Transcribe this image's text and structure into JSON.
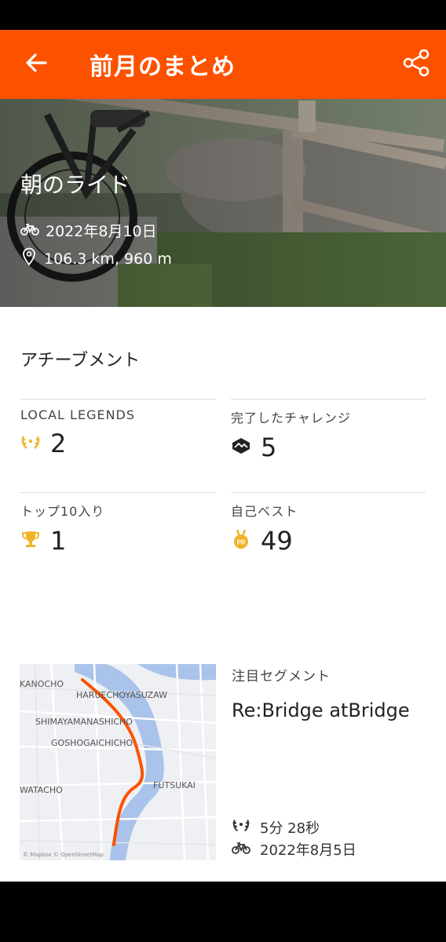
{
  "header": {
    "title": "前月のまとめ",
    "back_icon": "arrow-left-icon",
    "share_icon": "share-icon",
    "accent": "#fc5200"
  },
  "activity": {
    "title": "朝のライド",
    "date": "2022年8月10日",
    "stats": "106.3 km, 960 m"
  },
  "achievements": {
    "title": "アチーブメント",
    "items": [
      {
        "label": "LOCAL LEGENDS",
        "value": "2",
        "icon": "laurel-icon"
      },
      {
        "label": "完了したチャレンジ",
        "value": "5",
        "icon": "challenge-icon"
      },
      {
        "label": "トップ10入り",
        "value": "1",
        "icon": "trophy-icon"
      },
      {
        "label": "自己ベスト",
        "value": "49",
        "icon": "pr-medal-icon"
      }
    ]
  },
  "segment": {
    "label": "注目セグメント",
    "name": "Re:Bridge atBridge",
    "time": "5分 28秒",
    "date": "2022年8月5日",
    "map_labels": [
      "KANOCHO",
      "HARUECHOYASUZAW",
      "SHIMAYAMANASHICHO",
      "GOSHOGAICHICHO",
      "FUTSUKAI",
      "WATACHO"
    ],
    "map_credit": "© Mapbox © OpenStreetMap"
  }
}
